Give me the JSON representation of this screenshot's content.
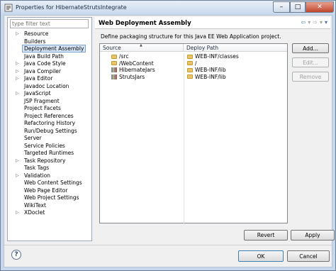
{
  "window": {
    "title": "Properties for HibernateStrutsIntegrate",
    "minimize": "–",
    "maximize": "□",
    "close": "✕"
  },
  "filter": {
    "placeholder": "type filter text"
  },
  "tree": [
    {
      "label": "Resource",
      "expandable": true
    },
    {
      "label": "Builders",
      "expandable": false
    },
    {
      "label": "Deployment Assembly",
      "expandable": false,
      "selected": true
    },
    {
      "label": "Java Build Path",
      "expandable": false
    },
    {
      "label": "Java Code Style",
      "expandable": true
    },
    {
      "label": "Java Compiler",
      "expandable": true
    },
    {
      "label": "Java Editor",
      "expandable": true
    },
    {
      "label": "Javadoc Location",
      "expandable": false
    },
    {
      "label": "JavaScript",
      "expandable": true
    },
    {
      "label": "JSP Fragment",
      "expandable": false
    },
    {
      "label": "Project Facets",
      "expandable": false
    },
    {
      "label": "Project References",
      "expandable": false
    },
    {
      "label": "Refactoring History",
      "expandable": false
    },
    {
      "label": "Run/Debug Settings",
      "expandable": false
    },
    {
      "label": "Server",
      "expandable": false
    },
    {
      "label": "Service Policies",
      "expandable": false
    },
    {
      "label": "Targeted Runtimes",
      "expandable": false
    },
    {
      "label": "Task Repository",
      "expandable": true
    },
    {
      "label": "Task Tags",
      "expandable": false
    },
    {
      "label": "Validation",
      "expandable": true
    },
    {
      "label": "Web Content Settings",
      "expandable": false
    },
    {
      "label": "Web Page Editor",
      "expandable": false
    },
    {
      "label": "Web Project Settings",
      "expandable": false
    },
    {
      "label": "WikiText",
      "expandable": false
    },
    {
      "label": "XDoclet",
      "expandable": true
    }
  ],
  "page": {
    "title": "Web Deployment Assembly",
    "description": "Define packaging structure for this Java EE Web Application project.",
    "nav": {
      "back": "⇦",
      "back_menu": "▾",
      "forward": "⇨",
      "forward_menu": "▾",
      "menu": "▾"
    }
  },
  "table": {
    "columns": [
      "Source",
      "Deploy Path"
    ],
    "rows": [
      {
        "source": "/src",
        "path": "WEB-INF/classes",
        "icon": "folder-icon"
      },
      {
        "source": "/WebContent",
        "path": "/",
        "icon": "folder-icon"
      },
      {
        "source": "HibernateJars",
        "path": "WEB-INF/lib",
        "icon": "library-icon"
      },
      {
        "source": "StrutsJars",
        "path": "WEB-INF/lib",
        "icon": "library-icon"
      }
    ]
  },
  "buttons": {
    "add": "Add...",
    "edit": "Edit...",
    "remove": "Remove",
    "revert": "Revert",
    "apply": "Apply",
    "ok": "OK",
    "cancel": "Cancel",
    "help": "?"
  }
}
